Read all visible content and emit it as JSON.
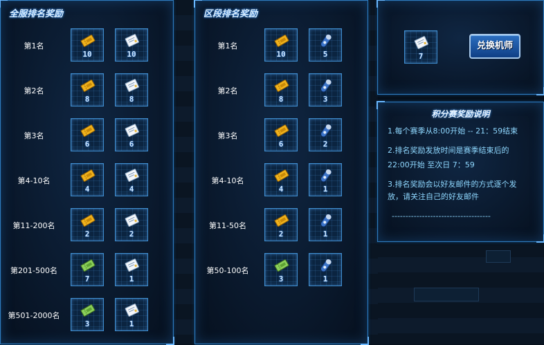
{
  "panels": {
    "server": {
      "title": "全服排名奖励",
      "rows": [
        {
          "rank": "第1名",
          "items": [
            {
              "icon": "gold-ticket-icon",
              "count": "10"
            },
            {
              "icon": "letter-card-icon",
              "count": "10"
            }
          ]
        },
        {
          "rank": "第2名",
          "items": [
            {
              "icon": "gold-ticket-icon",
              "count": "8"
            },
            {
              "icon": "letter-card-icon",
              "count": "8"
            }
          ]
        },
        {
          "rank": "第3名",
          "items": [
            {
              "icon": "gold-ticket-icon",
              "count": "6"
            },
            {
              "icon": "letter-card-icon",
              "count": "6"
            }
          ]
        },
        {
          "rank": "第4-10名",
          "items": [
            {
              "icon": "gold-ticket-icon",
              "count": "4"
            },
            {
              "icon": "letter-card-icon",
              "count": "4"
            }
          ]
        },
        {
          "rank": "第11-200名",
          "items": [
            {
              "icon": "gold-ticket-icon",
              "count": "2"
            },
            {
              "icon": "letter-card-icon",
              "count": "2"
            }
          ]
        },
        {
          "rank": "第201-500名",
          "items": [
            {
              "icon": "green-ticket-icon",
              "count": "7"
            },
            {
              "icon": "letter-card-icon",
              "count": "1"
            }
          ]
        },
        {
          "rank": "第501-2000名",
          "items": [
            {
              "icon": "green-ticket-icon",
              "count": "3"
            },
            {
              "icon": "letter-card-icon",
              "count": "1"
            }
          ]
        }
      ]
    },
    "district": {
      "title": "区段排名奖励",
      "rows": [
        {
          "rank": "第1名",
          "items": [
            {
              "icon": "gold-ticket-icon",
              "count": "10"
            },
            {
              "icon": "capsule-icon",
              "count": "5"
            }
          ]
        },
        {
          "rank": "第2名",
          "items": [
            {
              "icon": "gold-ticket-icon",
              "count": "8"
            },
            {
              "icon": "capsule-icon",
              "count": "3"
            }
          ]
        },
        {
          "rank": "第3名",
          "items": [
            {
              "icon": "gold-ticket-icon",
              "count": "6"
            },
            {
              "icon": "capsule-icon",
              "count": "2"
            }
          ]
        },
        {
          "rank": "第4-10名",
          "items": [
            {
              "icon": "gold-ticket-icon",
              "count": "4"
            },
            {
              "icon": "capsule-icon",
              "count": "1"
            }
          ]
        },
        {
          "rank": "第11-50名",
          "items": [
            {
              "icon": "gold-ticket-icon",
              "count": "2"
            },
            {
              "icon": "capsule-icon",
              "count": "1"
            }
          ]
        },
        {
          "rank": "第50-100名",
          "items": [
            {
              "icon": "green-ticket-icon",
              "count": "3"
            },
            {
              "icon": "capsule-icon",
              "count": "1"
            }
          ]
        }
      ]
    }
  },
  "exchange": {
    "item": {
      "icon": "letter-card-icon",
      "count": "7"
    },
    "button_label": "兑换机师"
  },
  "rules": {
    "title": "积分赛奖励说明",
    "lines": [
      "1.每个赛季从8:00开始 -- 21：59结束",
      "2.排名奖励发放时间是赛季结束后的",
      "22:00开始 至次日 7：59",
      "3.排名奖励会以好友邮件的方式逐个发",
      "放，请关注自己的好友邮件"
    ],
    "divider": "------------------------------------"
  },
  "colors": {
    "accent": "#2f7bbd",
    "rules_text": "#8fd8ff",
    "gold_ticket": "#f0b21c",
    "green_ticket": "#8bd05a",
    "button": "#1f5aa8"
  }
}
